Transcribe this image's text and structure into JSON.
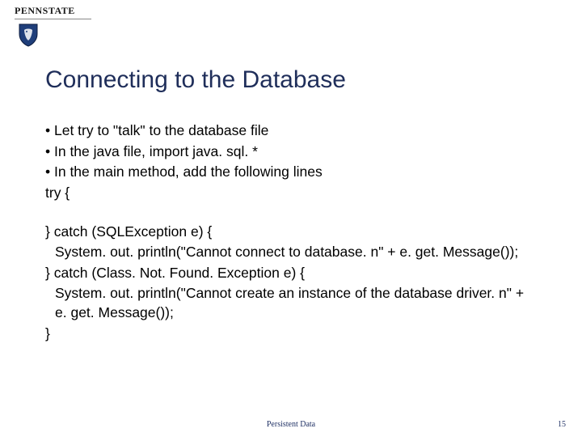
{
  "logo": {
    "text": "PENNSTATE",
    "shield_fill": "#1f3e7a",
    "shield_stroke": "#0d1d40"
  },
  "title": "Connecting to the Database",
  "bullets": [
    "• Let try to \"talk\" to the database file",
    "• In the java file, import java. sql. *",
    "• In the main method, add the following lines"
  ],
  "code": {
    "try_open": "try {",
    "catch1": "} catch (SQLException e) {",
    "catch1_body": "  System. out. println(\"Cannot connect to database. n\" + e. get. Message());",
    "catch2": "} catch (Class. Not. Found. Exception e) {",
    "catch2_body": "  System. out. println(\"Cannot create an instance of the database driver. n\" + e. get. Message());",
    "close": "}"
  },
  "footer": {
    "center": "Persistent Data",
    "page": "15"
  }
}
